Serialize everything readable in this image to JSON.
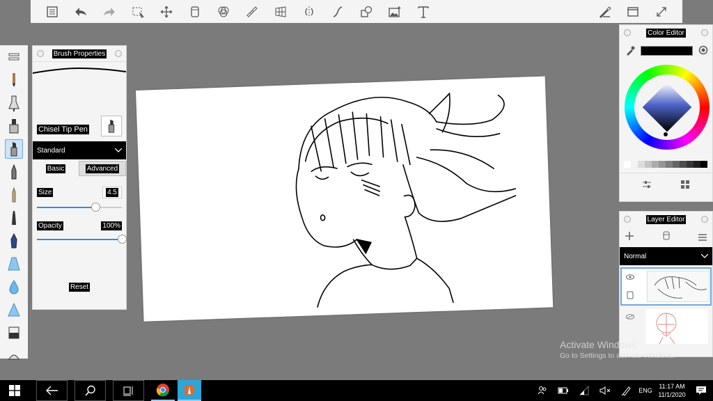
{
  "brush_panel": {
    "title": "Brush Properties",
    "brush_name": "Chisel Tip Pen",
    "category": "Standard",
    "tabs": [
      "Basic",
      "Advanced"
    ],
    "size_label": "Size",
    "size_value": "4.5",
    "size_fraction": 0.69,
    "opacity_label": "Opacity",
    "opacity_value": "100%",
    "opacity_fraction": 1.0,
    "reset_label": "Reset"
  },
  "color_editor": {
    "title": "Color Editor",
    "current_color": "#000000",
    "swatches": [
      "#ffffff",
      "#f2f2f2",
      "#dcdcdc",
      "#c4c4c4",
      "#acacac",
      "#959595",
      "#7d7d7d",
      "#656565",
      "#4d4d4d",
      "#363636",
      "#1e1e1e",
      "#000000"
    ]
  },
  "layer_editor": {
    "title": "Layer Editor",
    "blend_mode": "Normal"
  },
  "toolbar": {
    "icons": [
      "list-icon",
      "undo-icon",
      "redo-icon",
      "selection-icon",
      "transform-icon",
      "layer-icon",
      "blend-icon",
      "ruler-icon",
      "perspective-icon",
      "symmetry-icon",
      "stroke-icon",
      "shapes-icon",
      "image-icon",
      "text-icon"
    ],
    "right_icons": [
      "brush-settings-icon",
      "window-icon",
      "fullscreen-icon"
    ]
  },
  "tools": [
    "pencil-icon",
    "technical-pen-icon",
    "marker-icon",
    "chisel-pen-icon",
    "brush-pen-icon",
    "airbrush-icon",
    "fineliner-icon",
    "calligraphy-icon",
    "soft-brush-icon",
    "blur-drop-icon",
    "smudge-icon",
    "eraser-icon",
    "fill-icon"
  ],
  "watermark": {
    "line1": "Activate Windows",
    "line2": "Go to Settings to activate Windows."
  },
  "taskbar": {
    "language": "ENG",
    "time": "11:17 AM",
    "date": "11/1/2020"
  }
}
